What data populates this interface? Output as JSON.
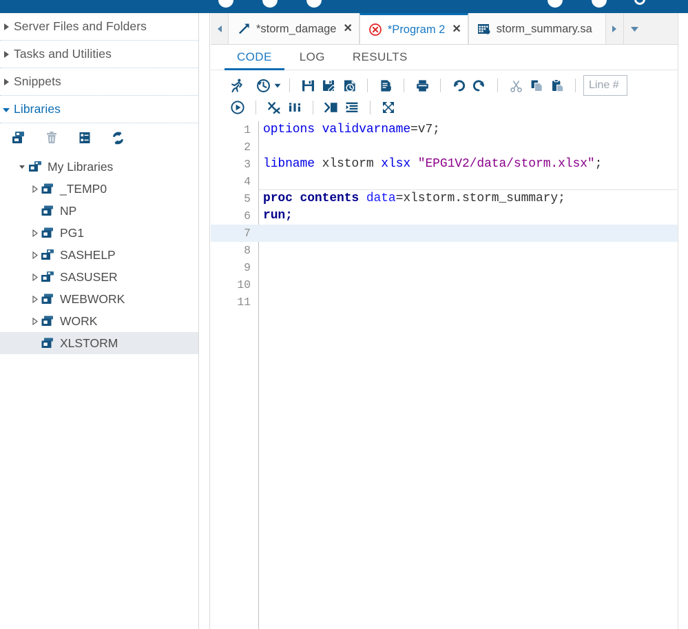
{
  "appbar": {
    "color": "#0b5c96",
    "icons": [
      "circle-icon",
      "circle-icon",
      "circle-icon",
      "dash-icon",
      "circle-icon",
      "circle-icon",
      "ring-icon"
    ]
  },
  "sidebar": {
    "sections": [
      {
        "label": "Server Files and Folders",
        "icon": "chevron-right-icon",
        "expanded": false
      },
      {
        "label": "Tasks and Utilities",
        "icon": "chevron-right-icon",
        "expanded": false
      },
      {
        "label": "Snippets",
        "icon": "chevron-right-icon",
        "expanded": false
      },
      {
        "label": "Libraries",
        "icon": "chevron-down-icon",
        "expanded": true
      }
    ],
    "library_toolbar": [
      {
        "name": "new-library-icon",
        "title": "New Library",
        "enabled": true
      },
      {
        "name": "delete-library-icon",
        "title": "Delete Library",
        "enabled": false
      },
      {
        "name": "library-properties-icon",
        "title": "Properties",
        "enabled": true
      },
      {
        "name": "refresh-icon",
        "title": "Refresh",
        "enabled": true
      }
    ],
    "tree": [
      {
        "label": "My Libraries",
        "icon": "libraries-root-icon",
        "level": 0,
        "twisty": "expanded",
        "selected": false
      },
      {
        "label": "_TEMP0",
        "icon": "library-icon",
        "level": 1,
        "twisty": "collapsed",
        "selected": false
      },
      {
        "label": "NP",
        "icon": "library-icon",
        "level": 1,
        "twisty": "none",
        "selected": false
      },
      {
        "label": "PG1",
        "icon": "library-icon",
        "level": 1,
        "twisty": "collapsed",
        "selected": false
      },
      {
        "label": "SASHELP",
        "icon": "library-group-icon",
        "level": 1,
        "twisty": "collapsed",
        "selected": false
      },
      {
        "label": "SASUSER",
        "icon": "library-group-icon",
        "level": 1,
        "twisty": "collapsed",
        "selected": false
      },
      {
        "label": "WEBWORK",
        "icon": "library-icon",
        "level": 1,
        "twisty": "collapsed",
        "selected": false
      },
      {
        "label": "WORK",
        "icon": "library-icon",
        "level": 1,
        "twisty": "collapsed",
        "selected": false
      },
      {
        "label": "XLSTORM",
        "icon": "library-icon",
        "level": 1,
        "twisty": "none",
        "selected": true
      }
    ]
  },
  "tabstrip": {
    "scroll_left_icon": "triangle-left-icon",
    "scroll_right_icon": "triangle-right-icon",
    "menu_icon": "chevron-down-icon",
    "tabs": [
      {
        "title": "*storm_damage",
        "icon": "flow-program-icon",
        "active": false,
        "close_label": "✕"
      },
      {
        "title": "*Program 2",
        "icon": "error-circle-icon",
        "active": true,
        "close_label": "✕"
      },
      {
        "title": "storm_summary.sa",
        "icon": "table-data-icon",
        "active": false,
        "close_label": ""
      }
    ]
  },
  "subtabs": [
    {
      "label": "CODE",
      "active": true
    },
    {
      "label": "LOG",
      "active": false
    },
    {
      "label": "RESULTS",
      "active": false
    }
  ],
  "editor_toolbar": {
    "row1": [
      {
        "name": "run-icon",
        "title": "Run"
      },
      {
        "name": "run-history-icon",
        "title": "Run History",
        "has_caret": true
      },
      {
        "name": "save-icon",
        "title": "Save"
      },
      {
        "name": "save-as-icon",
        "title": "Save As"
      },
      {
        "name": "save-with-options-icon",
        "title": "Save With Options"
      },
      {
        "name": "properties-icon",
        "title": "Properties"
      },
      {
        "name": "print-icon",
        "title": "Print"
      },
      {
        "name": "undo-icon",
        "title": "Undo"
      },
      {
        "name": "redo-icon",
        "title": "Redo"
      },
      {
        "name": "cut-icon",
        "title": "Cut"
      },
      {
        "name": "copy-icon",
        "title": "Copy"
      },
      {
        "name": "paste-icon",
        "title": "Paste"
      }
    ],
    "line_number_placeholder": "Line #",
    "row2": [
      {
        "name": "local-submit-icon",
        "title": "Submit"
      },
      {
        "name": "clear-all-icon",
        "title": "Clear All"
      },
      {
        "name": "analyze-program-icon",
        "title": "Analyze Program"
      },
      {
        "name": "add-snippet-icon",
        "title": "Add to Snippets"
      },
      {
        "name": "format-code-icon",
        "title": "Format Code"
      },
      {
        "name": "maximize-view-icon",
        "title": "Maximize View"
      }
    ]
  },
  "code": {
    "current_line": 7,
    "separator_after_line": 4,
    "total_lines": 11,
    "lines": [
      {
        "n": 1,
        "tokens": [
          {
            "t": "options ",
            "c": "kw"
          },
          {
            "t": "validvarname",
            "c": "kw"
          },
          {
            "t": "=v7;",
            "c": "plain"
          }
        ]
      },
      {
        "n": 2,
        "tokens": []
      },
      {
        "n": 3,
        "tokens": [
          {
            "t": "libname",
            "c": "kw"
          },
          {
            "t": " xlstorm ",
            "c": "plain"
          },
          {
            "t": "xlsx",
            "c": "kw"
          },
          {
            "t": " ",
            "c": "plain"
          },
          {
            "t": "\"EPG1V2/data/storm.xlsx\"",
            "c": "str"
          },
          {
            "t": ";",
            "c": "plain"
          }
        ]
      },
      {
        "n": 4,
        "tokens": []
      },
      {
        "n": 5,
        "tokens": [
          {
            "t": "proc contents ",
            "c": "kwb"
          },
          {
            "t": "data",
            "c": "blue"
          },
          {
            "t": "=xlstorm.storm_summary;",
            "c": "plain"
          }
        ]
      },
      {
        "n": 6,
        "tokens": [
          {
            "t": "run;",
            "c": "kwb"
          }
        ]
      },
      {
        "n": 7,
        "tokens": []
      },
      {
        "n": 8,
        "tokens": []
      },
      {
        "n": 9,
        "tokens": []
      },
      {
        "n": 10,
        "tokens": []
      },
      {
        "n": 11,
        "tokens": []
      }
    ]
  },
  "colors": {
    "brand_blue": "#0b5c96",
    "accent_blue": "#0b6cb3",
    "link_blue": "#1979c4",
    "icon_navy": "#14527e",
    "error_red": "#e02020",
    "selection_grey": "#e7eaee",
    "current_line": "#e8f1f9"
  }
}
